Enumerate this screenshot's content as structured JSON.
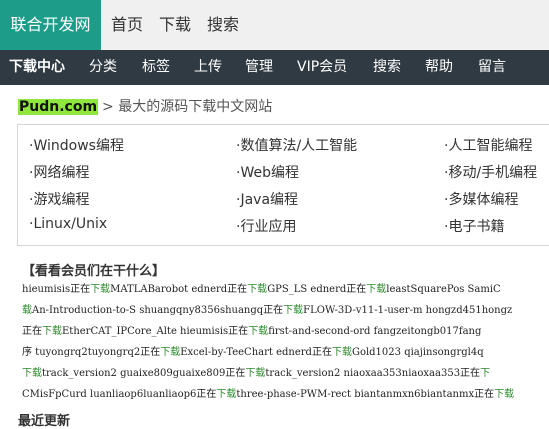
{
  "topnav": {
    "brand": "联合开发网",
    "links": [
      "首页",
      "下载",
      "搜索"
    ]
  },
  "mainnav": {
    "items": [
      "下载中心",
      "分类",
      "标签",
      "上传",
      "管理",
      "VIP会员",
      "搜索",
      "帮助",
      "留言"
    ]
  },
  "site": {
    "logo": "Pudn.com",
    "tagline": "> 最大的源码下载中文网站"
  },
  "categories": [
    "·Windows编程",
    "·数值算法/人工智能",
    "·人工智能编程",
    "·网络编程",
    "·Web编程",
    "·移动/手机编程",
    "·游戏编程",
    "·Java编程",
    "·多媒体编程",
    "·Linux/Unix",
    "·行业应用",
    "·电子书籍"
  ],
  "members": {
    "title": "【看看会员们在干什么】",
    "lines": [
      [
        "hieumisis正在",
        "下载",
        "MATLABarobot  ednerd正在",
        "下载",
        "GPS_LS  ednerd正在",
        "下载",
        "leastSquarePos  SamiC"
      ],
      [
        "",
        "载",
        "An-Introduction-to-S  shuangqny8356shuangq正在",
        "下载",
        "FLOW-3D-v11-1-user-m  hongzd451hongz"
      ],
      [
        "正在",
        "下载",
        "EtherCAT_IPCore_Alte  hieumisis正在",
        "下载",
        "first-and-second-ord  fangzeitongb017fang"
      ],
      [
        "序  tuyongrq2tuyongrq2正在",
        "下载",
        "Excel-by-TeeChart  ednerd正在",
        "下载",
        "Gold1023  qiajinsongrgl4q"
      ],
      [
        "",
        "下载",
        "track_version2  guaixe809guaixe809正在",
        "下载",
        "track_version2  niaoxaa353niaoxaa353正在",
        "下"
      ],
      [
        "CMisFpCurd  luanliaop6luanliaop6正在",
        "下载",
        "three-phase-PWM-rect  biantanmxn6biantanmx正在",
        "下载"
      ]
    ]
  },
  "next_section": "最近更新"
}
